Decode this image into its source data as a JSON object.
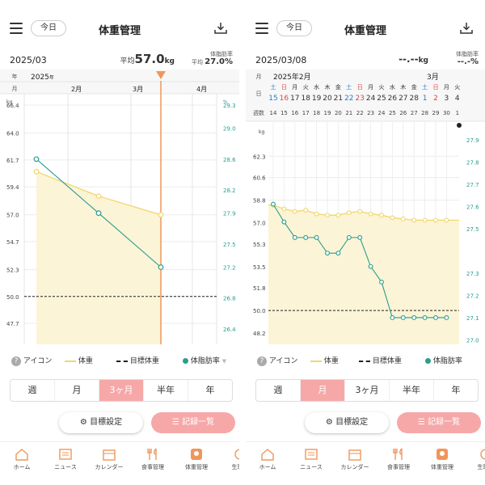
{
  "colors": {
    "accent": "#f6a8a8",
    "weight": "#f2d66b",
    "fat": "#2a9d8f",
    "fill": "#fbf4d6",
    "marker": "#f0965a"
  },
  "common": {
    "today": "今日",
    "title": "体重管理",
    "fat_label": "体脂肪率",
    "legend": {
      "icon": "アイコン",
      "weight": "体重",
      "target": "目標体重",
      "fat": "体脂肪率"
    },
    "periods": [
      "週",
      "月",
      "3ヶ月",
      "半年",
      "年"
    ],
    "goal_button": "目標設定",
    "log_button": "記録一覧",
    "nav": [
      "ホーム",
      "ニュース",
      "カレンダー",
      "食事管理",
      "体重管理",
      "生理日"
    ],
    "kg": "kg",
    "pct": "%"
  },
  "left": {
    "date": "2025/03",
    "avg_prefix": "平均",
    "avg_value": "57.0",
    "avg_unit": "kg",
    "fat_prefix": "平均",
    "fat_value": "27.0",
    "fat_unit": "%",
    "year_label": "年",
    "month_label": "月",
    "year": "2025",
    "year_suffix": "年",
    "months": [
      "2月",
      "3月",
      "4月"
    ],
    "active_period": 2,
    "chart_data": {
      "type": "line",
      "x": [
        "2025-01",
        "2025-02",
        "2025-03"
      ],
      "series": [
        {
          "name": "体重",
          "values": [
            60.7,
            58.6,
            57.0
          ]
        },
        {
          "name": "体脂肪率",
          "values": [
            28.6,
            27.9,
            27.2
          ]
        }
      ],
      "target_weight": 50.0,
      "ylim": [
        45.9,
        66.4
      ],
      "y2lim": [
        26.2,
        29.3
      ],
      "yticks": [
        66.4,
        64.0,
        61.7,
        59.4,
        57.0,
        54.7,
        52.3,
        50.0,
        47.7
      ],
      "y2ticks": [
        29.3,
        29.0,
        28.6,
        28.2,
        27.9,
        27.5,
        27.2,
        26.8,
        26.4
      ],
      "ylabel": "kg",
      "y2label": "%"
    }
  },
  "right": {
    "date": "2025/03/08",
    "weight_value": "--.--",
    "weight_unit": "kg",
    "fat_value": "--.-",
    "fat_unit": "%",
    "month_label": "月",
    "day_label": "日",
    "week_label": "週数",
    "month_a": "2025年2月",
    "month_b": "3月",
    "weekdays": [
      "土",
      "日",
      "月",
      "火",
      "水",
      "木",
      "金",
      "土",
      "日",
      "月",
      "火",
      "水",
      "木",
      "金",
      "土",
      "日",
      "月",
      "火"
    ],
    "days": [
      "15",
      "16",
      "17",
      "18",
      "19",
      "20",
      "21",
      "22",
      "23",
      "24",
      "25",
      "26",
      "27",
      "28",
      "1",
      "2",
      "3",
      "4"
    ],
    "weeks": [
      "14",
      "15",
      "16",
      "17",
      "18",
      "19",
      "20",
      "21",
      "22",
      "23",
      "24",
      "25",
      "26",
      "27",
      "28",
      "29",
      "30",
      "1"
    ],
    "active_period": 1,
    "chart_data": {
      "type": "line",
      "x": [
        "2025-02-15",
        "2025-02-16",
        "2025-02-17",
        "2025-02-18",
        "2025-02-19",
        "2025-02-20",
        "2025-02-21",
        "2025-02-22",
        "2025-02-23",
        "2025-02-24",
        "2025-02-25",
        "2025-02-26",
        "2025-02-27",
        "2025-02-28",
        "2025-03-01",
        "2025-03-02",
        "2025-03-03"
      ],
      "series": [
        {
          "name": "体重",
          "values": [
            58.4,
            58.1,
            57.9,
            58.0,
            57.7,
            57.6,
            57.6,
            57.8,
            57.9,
            57.7,
            57.6,
            57.4,
            57.3,
            57.2,
            57.2,
            57.2,
            57.2
          ]
        },
        {
          "name": "体脂肪率",
          "values": [
            27.61,
            27.53,
            27.46,
            27.46,
            27.46,
            27.39,
            27.39,
            27.46,
            27.46,
            27.33,
            27.26,
            27.1,
            27.1,
            27.1,
            27.1,
            27.1,
            27.1
          ]
        }
      ],
      "target_weight": 50.0,
      "ylim": [
        47.3,
        63.8
      ],
      "y2lim": [
        26.98,
        27.91
      ],
      "yticks": [
        62.3,
        60.6,
        58.8,
        57.0,
        55.3,
        53.5,
        51.8,
        50.0,
        48.2
      ],
      "y2ticks": [
        27.9,
        27.8,
        27.7,
        27.6,
        27.5,
        27.3,
        27.2,
        27.1,
        27.0
      ],
      "ylabel": "kg",
      "y2label": "%"
    }
  }
}
